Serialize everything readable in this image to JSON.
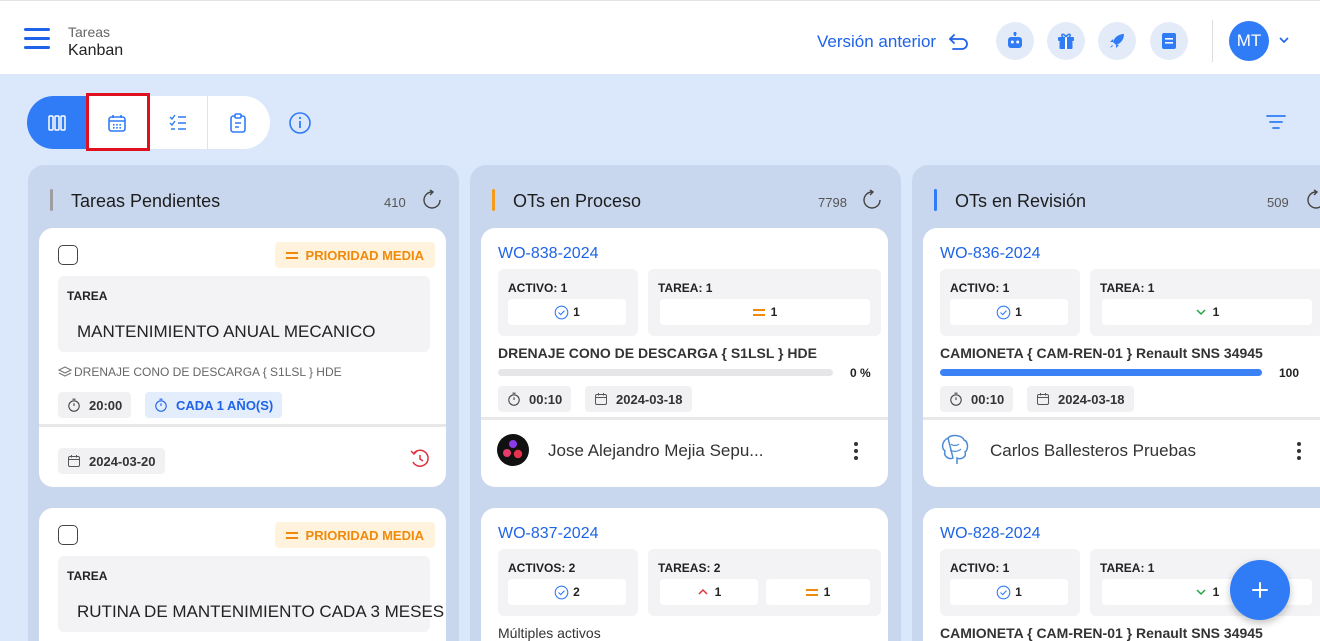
{
  "header": {
    "breadcrumb_parent": "Tareas",
    "breadcrumb_current": "Kanban",
    "prev_version_label": "Versión anterior",
    "avatar_initials": "MT",
    "action_icons": [
      "robot-icon",
      "gift-icon",
      "rocket-icon",
      "notes-icon"
    ]
  },
  "toolbar": {
    "views": [
      "kanban-view-icon",
      "calendar-view-icon",
      "checklist-view-icon",
      "clipboard-view-icon"
    ],
    "active_view": "kanban",
    "highlighted_view": "calendar"
  },
  "colors": {
    "accent": "#2f7cf6",
    "link": "#1e63e8",
    "priority_medium": "#f08a0c",
    "col_pending": "#9e9e9e",
    "col_process": "#f59c1a",
    "col_review": "#2f7cf6"
  },
  "columns": [
    {
      "title": "Tareas Pendientes",
      "count": "410",
      "cards": [
        {
          "priority": "PRIORIDAD MEDIA",
          "task_label": "TAREA",
          "task_name": "MANTENIMIENTO ANUAL  MECANICO",
          "asset": "DRENAJE CONO DE DESCARGA { S1LSL } HDE",
          "duration": "20:00",
          "frequency": "CADA 1 AÑO(S)",
          "date": "2024-03-20"
        },
        {
          "priority": "PRIORIDAD MEDIA",
          "task_label": "TAREA",
          "task_name": "RUTINA DE MANTENIMIENTO CADA 3 MESES"
        }
      ]
    },
    {
      "title": "OTs en Proceso",
      "count": "7798",
      "cards": [
        {
          "code": "WO-838-2024",
          "assets_label": "ACTIVO: 1",
          "assets_count": "1",
          "tasks_label": "TAREA: 1",
          "tasks_count": "1",
          "asset_title": "DRENAJE CONO DE DESCARGA { S1LSL } HDE",
          "progress_text": "0 %",
          "progress_value": 0,
          "duration": "00:10",
          "date": "2024-03-18",
          "user": "Jose Alejandro Mejia Sepu..."
        },
        {
          "code": "WO-837-2024",
          "assets_label": "ACTIVOS: 2",
          "assets_count": "2",
          "tasks_label": "TAREAS: 2",
          "tasks_high": "1",
          "tasks_medium": "1",
          "asset_title": "Múltiples activos"
        }
      ]
    },
    {
      "title": "OTs en Revisión",
      "count": "509",
      "cards": [
        {
          "code": "WO-836-2024",
          "assets_label": "ACTIVO: 1",
          "assets_count": "1",
          "tasks_label": "TAREA: 1",
          "tasks_count": "1",
          "asset_title": "CAMIONETA { CAM-REN-01 } Renault SNS 34945",
          "progress_text": "100",
          "progress_value": 100,
          "duration": "00:10",
          "date": "2024-03-18",
          "user": "Carlos Ballesteros Pruebas"
        },
        {
          "code": "WO-828-2024",
          "assets_label": "ACTIVO: 1",
          "assets_count": "1",
          "tasks_label": "TAREA: 1",
          "tasks_count": "1",
          "asset_title": "CAMIONETA { CAM-REN-01 } Renault SNS 34945"
        }
      ]
    }
  ]
}
